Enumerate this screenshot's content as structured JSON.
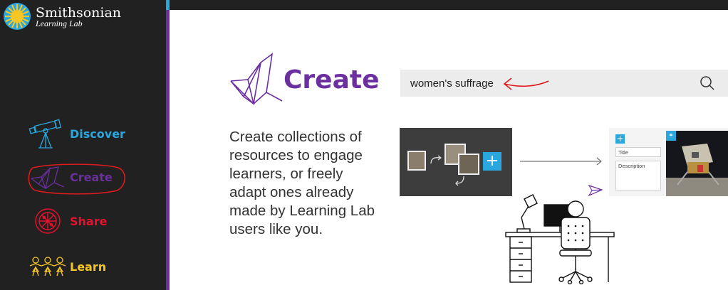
{
  "brand": {
    "title": "Smithsonian",
    "subtitle": "Learning Lab"
  },
  "sidebar": {
    "items": [
      {
        "label": "Discover",
        "icon": "telescope-icon",
        "color": "#2aa7df"
      },
      {
        "label": "Create",
        "icon": "origami-crane-icon",
        "color": "#6b2fa0"
      },
      {
        "label": "Share",
        "icon": "share-circle-icon",
        "color": "#e8112d"
      },
      {
        "label": "Learn",
        "icon": "people-chain-icon",
        "color": "#f6c625"
      }
    ]
  },
  "main": {
    "heading": "Create",
    "description": "Create collections of resources to engage learners, or freely adapt ones already made by Learning Lab users like you.",
    "search": {
      "value": "women's suffrage"
    },
    "illustration": {
      "title_field": "Title",
      "description_field": "Description"
    }
  },
  "colors": {
    "sidebar_bg": "#212121",
    "create_purple": "#6b2fa0",
    "discover_blue": "#2aa7df",
    "share_red": "#e8112d",
    "learn_yellow": "#f6c625",
    "annotation_red": "#e01b1b"
  }
}
